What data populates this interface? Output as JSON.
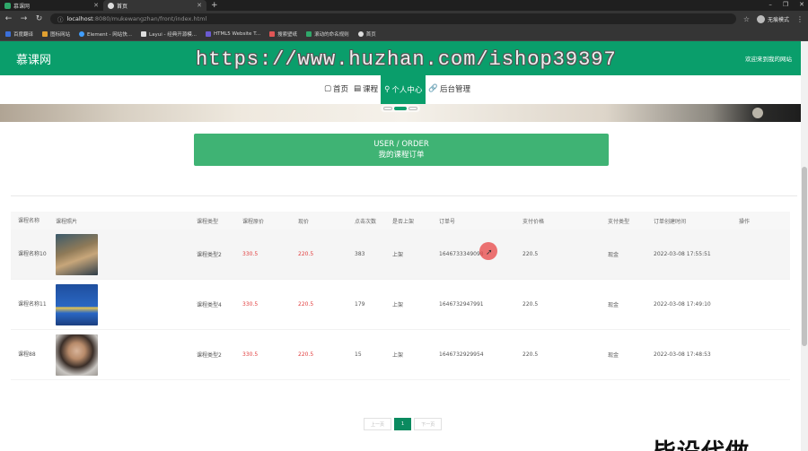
{
  "browser": {
    "tabs": [
      {
        "title": "慕课网",
        "active": false
      },
      {
        "title": "首页",
        "active": true
      }
    ],
    "url": {
      "host": "localhost",
      "rest": ":8080/mukewangzhan/front/index.html"
    },
    "profile": "无痕模式",
    "bookmarks": [
      "百度翻译",
      "图标网站",
      "Element - 网站快...",
      "Layui - 经典开源模...",
      "HTML5 Website T...",
      "搜索壁纸",
      "滚动的命名规则",
      "首页"
    ]
  },
  "header": {
    "brand": "慕课网",
    "welcome": "欢迎来到我的网站"
  },
  "menu": [
    {
      "icon": "▢",
      "label": "首页",
      "active": false
    },
    {
      "icon": "▤",
      "label": "课程",
      "active": false
    },
    {
      "icon": "⚲",
      "label": "个人中心",
      "active": true
    },
    {
      "icon": "🔗",
      "label": "后台管理",
      "active": false
    }
  ],
  "watermark": "https://www.huzhan.com/ishop39397",
  "title_box": {
    "line1": "USER / ORDER",
    "line2": "我的课程订单"
  },
  "table": {
    "headers": [
      "课程名称",
      "课程照片",
      "课程类型",
      "课程原价",
      "现价",
      "点击次数",
      "是否上架",
      "订单号",
      "支付价格",
      "支付类型",
      "订单创建时间",
      "操作"
    ],
    "rows": [
      {
        "name": "课程名称10",
        "type": "课程类型2",
        "orig": "330.5",
        "price": "220.5",
        "clicks": "383",
        "shelf": "上架",
        "order": "1646733349098",
        "paid": "220.5",
        "paytype": "现金",
        "time": "2022-03-08 17:55:51"
      },
      {
        "name": "课程名称11",
        "type": "课程类型4",
        "orig": "330.5",
        "price": "220.5",
        "clicks": "179",
        "shelf": "上架",
        "order": "1646732947991",
        "paid": "220.5",
        "paytype": "现金",
        "time": "2022-03-08 17:49:10"
      },
      {
        "name": "课程88",
        "type": "课程类型2",
        "orig": "330.5",
        "price": "220.5",
        "clicks": "15",
        "shelf": "上架",
        "order": "1646732929954",
        "paid": "220.5",
        "paytype": "现金",
        "time": "2022-03-08 17:48:53"
      }
    ]
  },
  "pager": {
    "prev": "上一页",
    "current": "1",
    "next": "下一页"
  },
  "overlay_text": "毕设代做",
  "colors": {
    "brand": "#0a9e6b",
    "price": "#e24040",
    "title_box": "#3fb374"
  }
}
